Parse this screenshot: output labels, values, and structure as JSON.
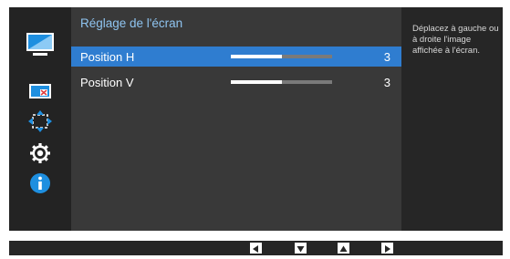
{
  "sidebar": {
    "items": [
      {
        "icon": "picture-icon"
      },
      {
        "icon": "onscreen-display-icon"
      },
      {
        "icon": "screen-position-icon"
      },
      {
        "icon": "setup-gear-icon"
      },
      {
        "icon": "information-icon"
      }
    ]
  },
  "menu": {
    "title": "Réglage de l'écran",
    "rows": [
      {
        "label": "Position H",
        "value": "3",
        "level": 0.5,
        "selected": true
      },
      {
        "label": "Position V",
        "value": "3",
        "level": 0.5,
        "selected": false
      }
    ]
  },
  "help": {
    "text": "Déplacez à gauche ou à droite l'image affichée à l'écran."
  },
  "nav": {
    "buttons": [
      "left-arrow-icon",
      "down-arrow-icon",
      "up-arrow-icon",
      "right-arrow-icon"
    ]
  },
  "colors": {
    "selected_row": "#2f7dd0",
    "title": "#8fc4f0",
    "accent_blue": "#1e8fe0"
  }
}
